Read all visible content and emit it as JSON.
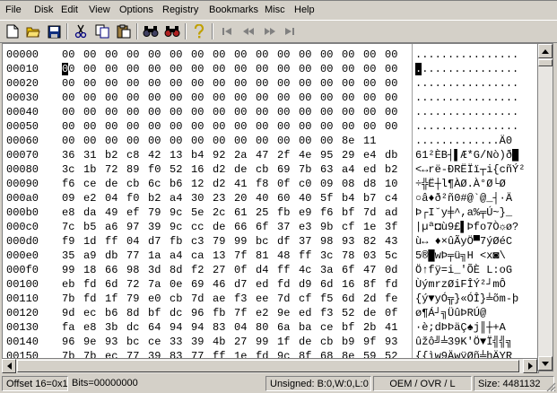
{
  "menu": [
    "File",
    "Disk",
    "Edit",
    "View",
    "Options",
    "Registry",
    "Bookmarks",
    "Misc",
    "Help"
  ],
  "toolbar": {
    "icons": [
      "new-file-icon",
      "open-folder-icon",
      "save-icon",
      "cut-icon",
      "copy-icon",
      "paste-icon",
      "find-icon",
      "find-next-icon",
      "help-icon",
      "first-icon",
      "prev-icon",
      "next-icon",
      "last-icon"
    ]
  },
  "editor": {
    "offsets": [
      "00000",
      "00010",
      "00020",
      "00030",
      "00040",
      "00050",
      "00060",
      "00070",
      "00080",
      "00090",
      "000a0",
      "000b0",
      "000c0",
      "000d0",
      "000e0",
      "000f0",
      "00100",
      "00110",
      "00120",
      "00130",
      "00140",
      "00150"
    ],
    "hex": [
      "00 00 00 00 00 00 00 00 00 00 00 00 00 00 00 00",
      "00 00 00 00 00 00 00 00 00 00 00 00 00 00 00 00",
      "00 00 00 00 00 00 00 00 00 00 00 00 00 00 00 00",
      "00 00 00 00 00 00 00 00 00 00 00 00 00 00 00 00",
      "00 00 00 00 00 00 00 00 00 00 00 00 00 00 00 00",
      "00 00 00 00 00 00 00 00 00 00 00 00 00 00 00 00",
      "00 00 00 00 00 00 00 00 00 00 00 00 00 8e 11",
      "36 31 b2 c8 42 13 b4 92 2a 47 2f 4e 95 29 e4 db",
      "3c 1b 72 89 f0 52 16 d2 de cb 69 7b 63 a4 ed b2",
      "f6 ce de cb 6c b6 12 d2 41 f8 0f c0 09 08 d8 10",
      "09 e2 04 f0 b2 a4 30 23 20 40 60 40 5f b4 b7 c4",
      "e8 da 49 ef 79 9c 5e 2c 61 25 fb e9 f6 bf 7d ad",
      "7c b5 a6 97 39 9c cc de 66 6f 37 e3 9b cf 1e 3f",
      "f9 1d ff 04 d7 fb c3 79 99 bc df 37 98 93 82 43",
      "35 a9 db 77 1a a4 ca 13 7f 81 48 ff 3c 78 03 5c",
      "99 18 66 98 3d 8d f2 27 0f d4 ff 4c 3a 6f 47 0d",
      "eb fd 6d 72 7a 0e 69 46 d7 ed fd d9 6d 16 8f fd",
      "7b fd 1f 79 e0 cb 7d ae f3 ee 7d cf f5 6d 2d fe",
      "9d ec b6 8d bf dc 96 fb 7f e2 9e ed f3 52 de 0f",
      "fa e8 3b dc 64 94 94 83 04 80 6a ba ce bf 2b 41",
      "96 9e 93 bc ce 33 39 4b 27 99 1f de cb b9 9f 93",
      "7b 7b ec 77 39 83 77 ff 1e fd 9c 8f 68 8e 59 52"
    ],
    "ascii": [
      "................",
      "................",
      "................",
      "................",
      "................",
      "................",
      ".............Ä0",
      "61²ÈB┤▌Æ*G/Nò)ð█",
      "<↔rë-ÐRËÏï┬i{cñÝ²",
      "÷╬Ë┼l¶ÀØ.À°Ø└Ø",
      "○â♦ð²ñ0#@`@_┤·Ä",
      "Þ┌I˘y╪^,a%╤Ú~}_",
      "|µª◘ù9£▌Þfo7Ò☼ø?",
      "ù↔ ♦×ûÃyÖ▀7ýØéC",
      "5®█wÞ╤ü╗H <x◙\\",
      "Ö↑fÿ=i_'ÕÈ L:oG",
      "ÙýmrzØiFÎÝ²┘mÔ",
      "{ý▼yÓ╦}«ÓÎ}╧õm-þ",
      "ø¶Á┘╗ÜûÞRÚ@",
      "·è;dÞÞäÇ♠j║┼+A",
      "ûžô╝╧39K'Ö▼Ï╣╣╗",
      "{{ìw9ÄwÿØñ╧hÄYR"
    ],
    "cursor_row": 1,
    "cursor_col": 0
  },
  "status": {
    "offset": "Offset 16=0x10",
    "bits": "Bits=00000000",
    "unsigned": "Unsigned: B:0,W:0,L:0",
    "mode": "OEM / OVR / L",
    "size": "Size: 4481132"
  }
}
